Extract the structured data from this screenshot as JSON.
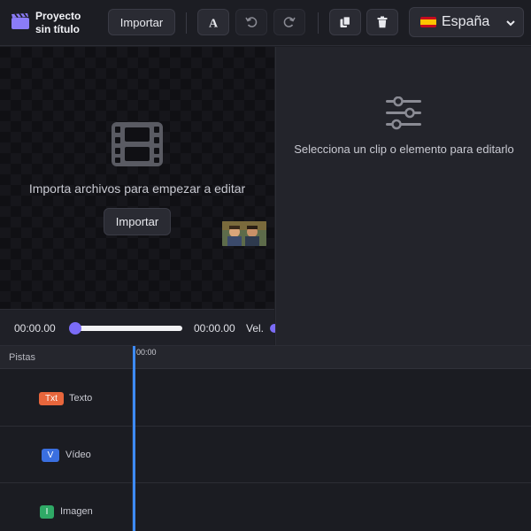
{
  "header": {
    "title": "Proyecto sin título",
    "import_label": "Importar",
    "language": "España"
  },
  "preview": {
    "message": "Importa archivos para empezar a editar",
    "import_label": "Importar"
  },
  "playback": {
    "current_time": "00:00.00",
    "total_time": "00:00.00",
    "speed_label": "Vel.",
    "progress": 0
  },
  "properties": {
    "message": "Selecciona un clip o elemento para editarlo"
  },
  "timeline": {
    "tracks_label": "Pistas",
    "ruler_start": "00:00",
    "tracks": [
      {
        "tag": "Txt",
        "name": "Texto",
        "color": "#e8663c"
      },
      {
        "tag": "V",
        "name": "Vídeo",
        "color": "#3a6fe0"
      },
      {
        "tag": "I",
        "name": "Imagen",
        "color": "#2fa966"
      }
    ]
  },
  "colors": {
    "accent": "#7b6cf6",
    "playhead": "#3d8bfd"
  }
}
